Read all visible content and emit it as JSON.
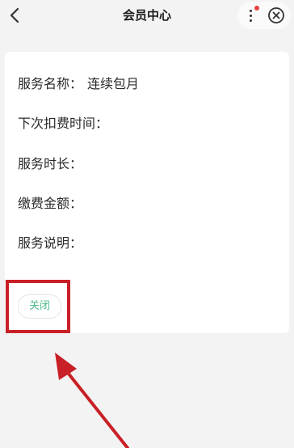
{
  "header": {
    "title": "会员中心"
  },
  "service": {
    "rows": [
      {
        "label": "服务名称：",
        "value": "连续包月"
      },
      {
        "label": "下次扣费时间：",
        "value": ""
      },
      {
        "label": "服务时长：",
        "value": ""
      },
      {
        "label": "缴费金额：",
        "value": ""
      },
      {
        "label": "服务说明：",
        "value": ""
      }
    ],
    "close_label": "关闭"
  },
  "icons": {
    "back": "chevron-left-icon",
    "more": "more-vertical-icon",
    "close": "close-circle-icon",
    "arrow": "annotation-arrow"
  },
  "colors": {
    "accent_green": "#4dbb8a",
    "highlight_red": "#c91f26",
    "badge_red": "#e64340"
  }
}
